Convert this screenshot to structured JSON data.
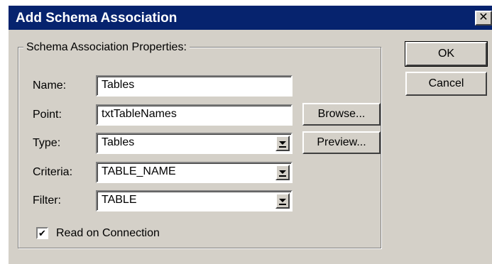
{
  "window": {
    "title": "Add Schema Association",
    "close_glyph": "✕"
  },
  "group": {
    "label": "Schema Association Properties:"
  },
  "fields": {
    "name": {
      "label": "Name:",
      "value": "Tables"
    },
    "point": {
      "label": "Point:",
      "value": "txtTableNames"
    },
    "type": {
      "label": "Type:",
      "value": "Tables"
    },
    "criteria": {
      "label": "Criteria:",
      "value": "TABLE_NAME"
    },
    "filter": {
      "label": "Filter:",
      "value": "TABLE"
    }
  },
  "buttons": {
    "ok": "OK",
    "cancel": "Cancel",
    "browse": "Browse...",
    "preview": "Preview..."
  },
  "checkbox": {
    "label": "Read on Connection",
    "checked": true,
    "mark": "✔"
  }
}
